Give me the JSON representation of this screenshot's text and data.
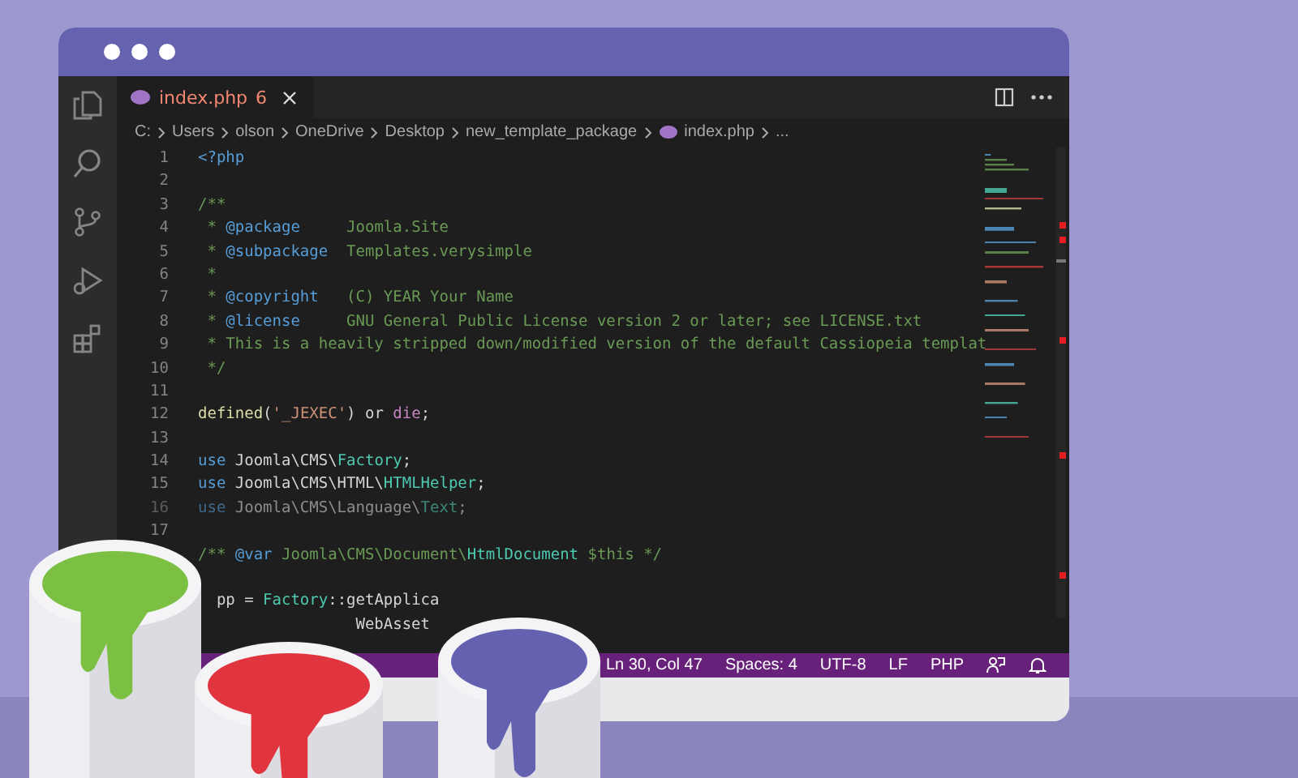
{
  "tab": {
    "label": "index.php",
    "count": "6"
  },
  "breadcrumb": {
    "parts": [
      "C:",
      "Users",
      "olson",
      "OneDrive",
      "Desktop",
      "new_template_package",
      "index.php",
      "..."
    ]
  },
  "code_lines": [
    {
      "number": "1",
      "tokens": [
        {
          "kind": "tag",
          "text": "<?php"
        }
      ]
    },
    {
      "number": "2"
    },
    {
      "number": "3",
      "tokens": [
        {
          "kind": "comment",
          "text": "/**"
        }
      ]
    },
    {
      "number": "4",
      "tokens": [
        {
          "kind": "comment",
          "text": " * "
        },
        {
          "kind": "doctag",
          "text": "@package"
        },
        {
          "kind": "comment",
          "text": "     Joomla.Site"
        }
      ]
    },
    {
      "number": "5",
      "tokens": [
        {
          "kind": "comment",
          "text": " * "
        },
        {
          "kind": "doctag",
          "text": "@subpackage"
        },
        {
          "kind": "comment",
          "text": "  Templates.verysimple"
        }
      ]
    },
    {
      "number": "6",
      "tokens": [
        {
          "kind": "comment",
          "text": " *"
        }
      ]
    },
    {
      "number": "7",
      "tokens": [
        {
          "kind": "comment",
          "text": " * "
        },
        {
          "kind": "doctag",
          "text": "@copyright"
        },
        {
          "kind": "comment",
          "text": "   (C) YEAR Your Name"
        }
      ]
    },
    {
      "number": "8",
      "tokens": [
        {
          "kind": "comment",
          "text": " * "
        },
        {
          "kind": "doctag",
          "text": "@license"
        },
        {
          "kind": "comment",
          "text": "     GNU General Public License version 2 or later; see LICENSE.txt"
        }
      ]
    },
    {
      "number": "9",
      "tokens": [
        {
          "kind": "comment",
          "text": " * This is a heavily stripped down/modified version of the default Cassiopeia templat"
        }
      ]
    },
    {
      "number": "10",
      "tokens": [
        {
          "kind": "comment",
          "text": " */"
        }
      ]
    },
    {
      "number": "11"
    },
    {
      "number": "12",
      "tokens": [
        {
          "kind": "function",
          "text": "defined"
        },
        {
          "kind": "plain",
          "text": "("
        },
        {
          "kind": "string",
          "text": "'_JEXEC'"
        },
        {
          "kind": "plain",
          "text": ") or "
        },
        {
          "kind": "control",
          "text": "die"
        },
        {
          "kind": "plain",
          "text": ";"
        }
      ]
    },
    {
      "number": "13"
    },
    {
      "number": "14",
      "tokens": [
        {
          "kind": "keyword",
          "text": "use"
        },
        {
          "kind": "plain",
          "text": " Joomla\\CMS\\"
        },
        {
          "kind": "class",
          "text": "Factory"
        },
        {
          "kind": "plain",
          "text": ";"
        }
      ]
    },
    {
      "number": "15",
      "tokens": [
        {
          "kind": "keyword",
          "text": "use"
        },
        {
          "kind": "plain",
          "text": " Joomla\\CMS\\HTML\\"
        },
        {
          "kind": "class",
          "text": "HTMLHelper"
        },
        {
          "kind": "plain",
          "text": ";"
        }
      ]
    },
    {
      "number": "16",
      "faded": true,
      "tokens": [
        {
          "kind": "keyword",
          "text": "use"
        },
        {
          "kind": "plain",
          "text": " Joomla\\CMS\\Language\\"
        },
        {
          "kind": "class",
          "text": "Text"
        },
        {
          "kind": "plain",
          "text": ";"
        }
      ]
    },
    {
      "number": "17"
    },
    {
      "tokens": [
        {
          "kind": "comment",
          "text": "/** "
        },
        {
          "kind": "doctag",
          "text": "@var"
        },
        {
          "kind": "comment",
          "text": " Joomla\\CMS\\Document\\"
        },
        {
          "kind": "class",
          "text": "HtmlDocument"
        },
        {
          "kind": "comment",
          "text": " $this */"
        }
      ]
    },
    {
      "gap_before": true,
      "tokens": [
        {
          "kind": "plain",
          "text": "  pp = "
        },
        {
          "kind": "class",
          "text": "Factory"
        },
        {
          "kind": "plain",
          "text": "::getApplica"
        }
      ]
    },
    {
      "tokens": [
        {
          "kind": "plain",
          "text": "                 WebAsset"
        }
      ]
    }
  ],
  "status_bar": {
    "items": [
      "Ln 30, Col 47",
      "Spaces: 4",
      "UTF-8",
      "LF",
      "PHP"
    ]
  },
  "paint_cans": [
    {
      "color": "#7bc043"
    },
    {
      "color": "#e0353f"
    },
    {
      "color": "#6462b0"
    }
  ]
}
